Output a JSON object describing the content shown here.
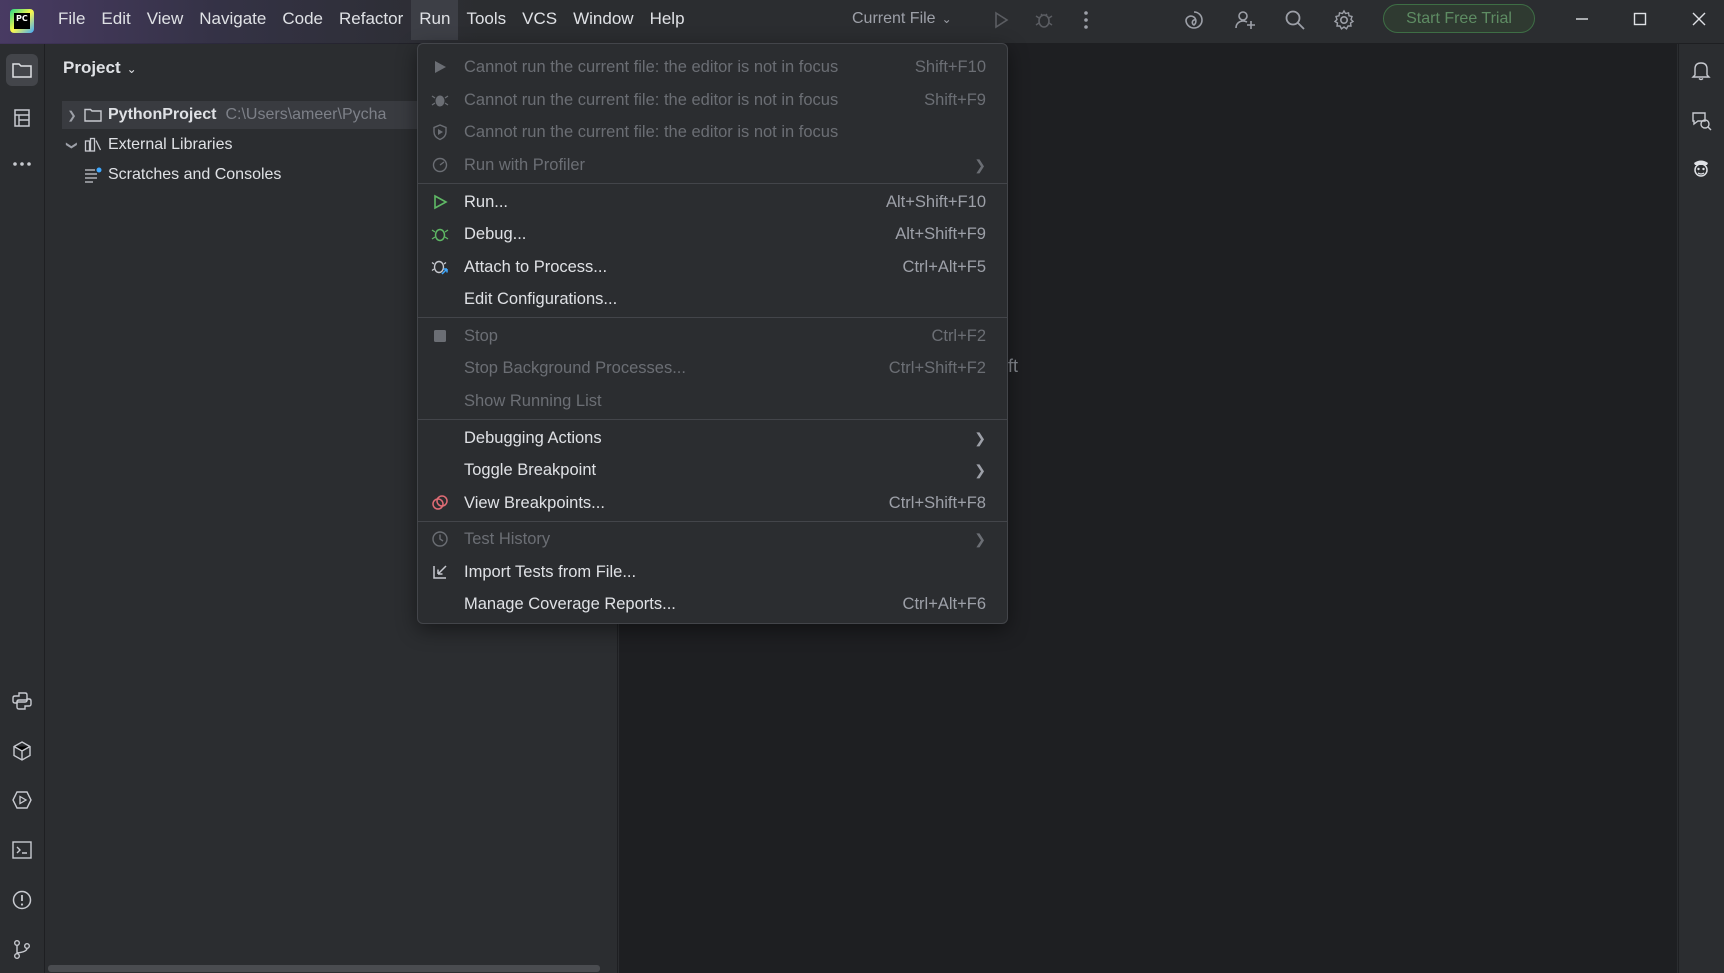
{
  "menubar": {
    "items": [
      {
        "label": "File"
      },
      {
        "label": "Edit"
      },
      {
        "label": "View"
      },
      {
        "label": "Navigate"
      },
      {
        "label": "Code"
      },
      {
        "label": "Refactor"
      },
      {
        "label": "Run"
      },
      {
        "label": "Tools"
      },
      {
        "label": "VCS"
      },
      {
        "label": "Window"
      },
      {
        "label": "Help"
      }
    ],
    "active": "Run"
  },
  "toolbar": {
    "run_config": "Current File",
    "trial_button": "Start Free Trial"
  },
  "project_panel": {
    "title": "Project",
    "tree": [
      {
        "name": "PythonProject",
        "path": "C:\\Users\\ameer\\Pycha"
      },
      {
        "name": "External Libraries"
      },
      {
        "name": "Scratches and Consoles"
      }
    ]
  },
  "editor": {
    "hint_fragment": "ft"
  },
  "run_menu": {
    "items": [
      {
        "label": "Cannot run the current file: the editor is not in focus",
        "shortcut": "Shift+F10",
        "icon": "run-icon",
        "disabled": true
      },
      {
        "label": "Cannot run the current file: the editor is not in focus",
        "shortcut": "Shift+F9",
        "icon": "debug-icon",
        "disabled": true
      },
      {
        "label": "Cannot run the current file: the editor is not in focus",
        "shortcut": "",
        "icon": "coverage-icon",
        "disabled": true
      },
      {
        "label": "Run with Profiler",
        "shortcut": "",
        "icon": "profiler-icon",
        "disabled": true,
        "submenu": true
      },
      {
        "label": "Run...",
        "shortcut": "Alt+Shift+F10",
        "icon": "run-icon",
        "disabled": false
      },
      {
        "label": "Debug...",
        "shortcut": "Alt+Shift+F9",
        "icon": "debug-icon",
        "disabled": false
      },
      {
        "label": "Attach to Process...",
        "shortcut": "Ctrl+Alt+F5",
        "icon": "attach-icon",
        "disabled": false
      },
      {
        "label": "Edit Configurations...",
        "shortcut": "",
        "icon": "",
        "disabled": false
      },
      {
        "label": "Stop",
        "shortcut": "Ctrl+F2",
        "icon": "stop-icon",
        "disabled": true
      },
      {
        "label": "Stop Background Processes...",
        "shortcut": "Ctrl+Shift+F2",
        "icon": "",
        "disabled": true
      },
      {
        "label": "Show Running List",
        "shortcut": "",
        "icon": "",
        "disabled": true
      },
      {
        "label": "Debugging Actions",
        "shortcut": "",
        "icon": "",
        "disabled": false,
        "submenu": true
      },
      {
        "label": "Toggle Breakpoint",
        "shortcut": "",
        "icon": "",
        "disabled": false,
        "submenu": true
      },
      {
        "label": "View Breakpoints...",
        "shortcut": "Ctrl+Shift+F8",
        "icon": "breakpoints-icon",
        "disabled": false
      },
      {
        "label": "Test History",
        "shortcut": "",
        "icon": "history-icon",
        "disabled": true,
        "submenu": true
      },
      {
        "label": "Import Tests from File...",
        "shortcut": "",
        "icon": "import-icon",
        "disabled": false
      },
      {
        "label": "Manage Coverage Reports...",
        "shortcut": "Ctrl+Alt+F6",
        "icon": "",
        "disabled": false
      }
    ]
  },
  "colors": {
    "background": "#2b2d30",
    "editor": "#1e1f22",
    "accent_green": "#5fb865",
    "breakpoint_red": "#e06c75"
  }
}
